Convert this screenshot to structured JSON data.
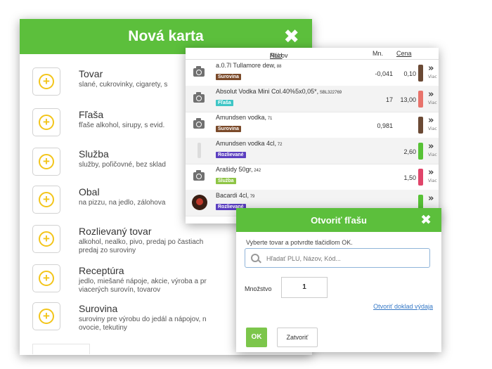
{
  "nova_karta": {
    "title": "Nová karta",
    "close": "✖",
    "items": [
      {
        "title": "Tovar",
        "desc": [
          "slané, cukrovinky, cigarety, s"
        ]
      },
      {
        "title": "Fľaša",
        "desc": [
          "fľaše alkohol, sirupy, s evid."
        ]
      },
      {
        "title": "Služba",
        "desc": [
          "služby, poľičovné, bez sklad"
        ]
      },
      {
        "title": "Obal",
        "desc": [
          "na pizzu, na jedlo, zálohova"
        ]
      },
      {
        "title": "Rozlievaný tovar",
        "desc": [
          "alkohol, nealko, pivo, predaj po častiach",
          "predaj zo suroviny"
        ]
      },
      {
        "title": "Receptúra",
        "desc": [
          "jedlo, miešané nápoje, akcie, výroba a pr",
          "viacerých surovín, tovarov"
        ]
      },
      {
        "title": "Surovina",
        "desc": [
          "suroviny pre výrobu do jedál a nápojov, n",
          "ovocie, tekutiny"
        ]
      }
    ]
  },
  "product_list": {
    "header": {
      "nazov": "Názov",
      "sep": " / ",
      "plu": "PLU",
      "mn": "Mn.",
      "cena": "Cena"
    },
    "rows": [
      {
        "icon": "camera-icon",
        "name": "a.0.7l Tullamore dew,",
        "code": " 88",
        "tag": "Surovina",
        "tag_color": "#7b4a2a",
        "mn": "-0,041",
        "cena": "0,10",
        "bar_color": "#6b4a35",
        "viac": "Viac"
      },
      {
        "icon": "camera-icon",
        "name": "Absolut Vodka Mini Col.40%5x0,05*,",
        "code": " SBL322769",
        "tag": "Fľaša",
        "tag_color": "#3fc6c6",
        "mn": "17",
        "cena": "13,00",
        "bar_color": "#e8736b",
        "viac": "Viac"
      },
      {
        "icon": "camera-icon",
        "name": "Amundsen vodka,",
        "code": " 71",
        "tag": "Surovina",
        "tag_color": "#7b4a2a",
        "mn": "0,981",
        "cena": "",
        "bar_color": "#6b4a35",
        "viac": "Viac"
      },
      {
        "icon": "bottle-icon",
        "name": "Amundsen vodka 4cl,",
        "code": " 72",
        "tag": "Rozlievané",
        "tag_color": "#5b3fc0",
        "mn": "",
        "cena": "2,60",
        "bar_color": "#57c236",
        "viac": "Viac"
      },
      {
        "icon": "camera-icon",
        "name": "Arašidy 50gr,",
        "code": " 242",
        "tag": "Služba",
        "tag_color": "#8ec545",
        "mn": "",
        "cena": "1,50",
        "bar_color": "#e0456a",
        "viac": "Viac"
      },
      {
        "icon": "bacardi-logo",
        "name": "Bacardi 4cl,",
        "code": " 79",
        "tag": "Rozlievané",
        "tag_color": "#5b3fc0",
        "mn": "",
        "cena": "",
        "bar_color": "#57c236",
        "viac": ""
      }
    ]
  },
  "otvorit_flasu": {
    "title": "Otvoriť fľašu",
    "close": "✖",
    "instruction": "Vyberte tovar a potvrdte tlačidlom OK.",
    "search_placeholder": "Hľadať PLU, Názov, Kód...",
    "quantity_label": "Množstvo",
    "quantity_value": "1",
    "link": "Otvoriť doklad výdaja",
    "ok": "OK",
    "close_button": "Zatvoriť"
  }
}
